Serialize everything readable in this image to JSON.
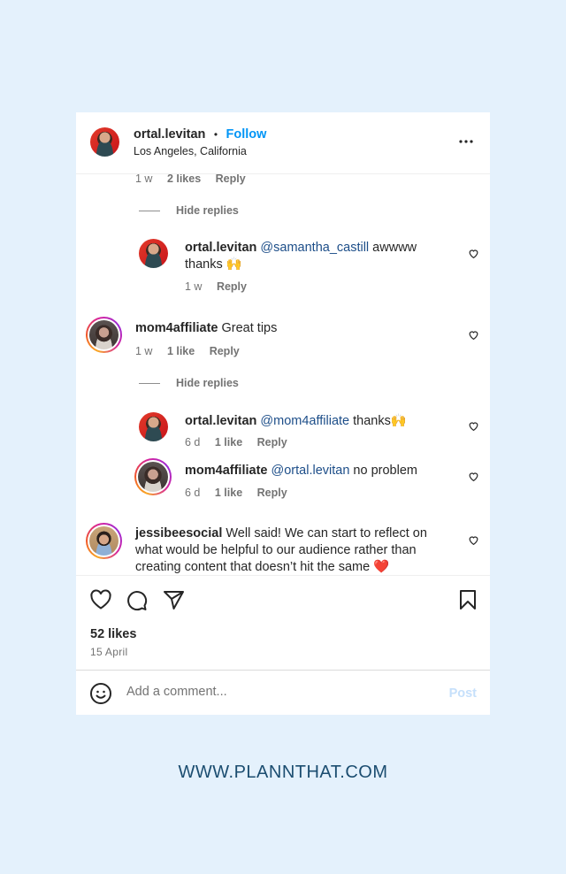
{
  "header": {
    "username": "ortal.levitan",
    "separator": "•",
    "follow_label": "Follow",
    "location": "Los Angeles, California",
    "more_icon": "more-horizontal-icon"
  },
  "comments": {
    "top_meta": {
      "time": "1 w",
      "likes": "2 likes",
      "reply": "Reply"
    },
    "hide_replies_1": "Hide replies",
    "reply_1": {
      "username": "ortal.levitan",
      "mention": "@samantha_castill",
      "text": " awwww thanks 🙌",
      "time": "1 w",
      "reply": "Reply"
    },
    "comment_2": {
      "username": "mom4affiliate",
      "text": " Great tips",
      "time": "1 w",
      "likes": "1 like",
      "reply": "Reply"
    },
    "hide_replies_2": "Hide replies",
    "reply_2": {
      "username": "ortal.levitan",
      "mention": "@mom4affiliate",
      "text": " thanks🙌",
      "time": "6 d",
      "likes": "1 like",
      "reply": "Reply"
    },
    "reply_3": {
      "username": "mom4affiliate",
      "mention": "@ortal.levitan",
      "text": " no problem",
      "time": "6 d",
      "likes": "1 like",
      "reply": "Reply"
    },
    "comment_3": {
      "username": "jessibeesocial",
      "text": " Well said! We can start to reflect on what would be helpful to our audience rather than creating content that doesn’t hit the same ❤️"
    }
  },
  "actions": {
    "likes": "52 likes",
    "date": "15 April"
  },
  "add_comment": {
    "placeholder": "Add a comment...",
    "post_label": "Post"
  },
  "colors": {
    "follow": "#0095f6",
    "mention": "#1d4e89",
    "post_disabled": "#c6e0fb",
    "page_bg": "#e4f1fc"
  },
  "footer": {
    "url": "WWW.PLANNTHAT.COM"
  }
}
